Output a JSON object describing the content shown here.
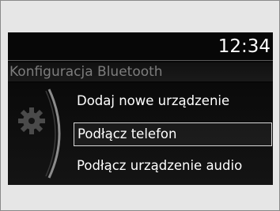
{
  "status": {
    "time": "12:34"
  },
  "screen": {
    "title": "Konfiguracja Bluetooth"
  },
  "menu": {
    "items": [
      {
        "label": "Dodaj nowe urządzenie",
        "selected": false
      },
      {
        "label": "Podłącz telefon",
        "selected": true
      },
      {
        "label": "Podłącz urządzenie audio",
        "selected": false
      }
    ]
  },
  "icons": {
    "settings": "gear-icon",
    "scroll": "scroll-arc-indicator"
  },
  "colors": {
    "screen_background": "#070707",
    "text": "#ffffff",
    "title_text": "#7d7d7d",
    "selection_border": "#d8d8d8"
  }
}
